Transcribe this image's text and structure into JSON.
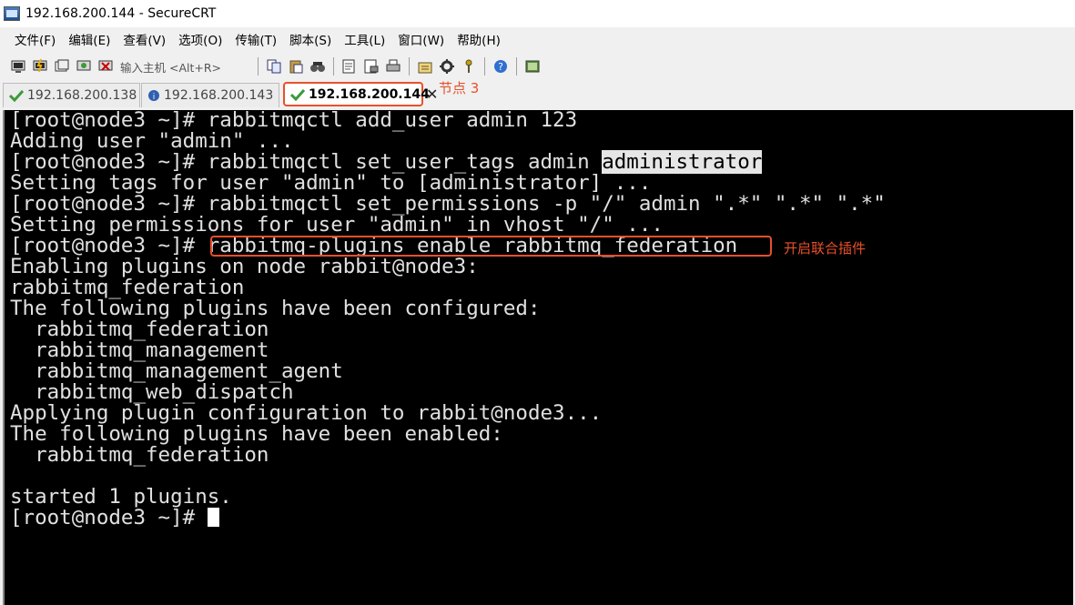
{
  "window": {
    "title": "192.168.200.144 - SecureCRT"
  },
  "menu": [
    "文件(F)",
    "编辑(E)",
    "查看(V)",
    "选项(O)",
    "传输(T)",
    "脚本(S)",
    "工具(L)",
    "窗口(W)",
    "帮助(H)"
  ],
  "toolbar": {
    "quick_connect_placeholder": "输入主机 <Alt+R>",
    "icons": [
      "connect-icon",
      "quick-connect-icon",
      "connect-tab-icon",
      "reconnect-icon",
      "disconnect-icon",
      "copy-icon",
      "paste-icon",
      "find-icon",
      "print-setup-icon",
      "print-icon",
      "printer-icon",
      "session-options-icon",
      "global-options-icon",
      "keymap-icon",
      "help-icon",
      "sftp-icon"
    ]
  },
  "tabs": [
    {
      "label": "192.168.200.138",
      "status_icon": "check-icon",
      "active": false
    },
    {
      "label": "192.168.200.143",
      "status_icon": "info-icon",
      "active": false
    },
    {
      "label": "192.168.200.144",
      "status_icon": "check-icon",
      "active": true
    }
  ],
  "annotations": {
    "tab_note": "节点 3",
    "command_note": "开启联合插件"
  },
  "terminal": {
    "lines": [
      "[root@node3 ~]# rabbitmqctl add_user admin 123",
      "Adding user \"admin\" ...",
      "[root@node3 ~]# rabbitmqctl set_user_tags admin ",
      "Setting tags for user \"admin\" to [administrator] ...",
      "[root@node3 ~]# rabbitmqctl set_permissions -p \"/\" admin \".*\" \".*\" \".*\"",
      "Setting permissions for user \"admin\" in vhost \"/\" ...",
      "[root@node3 ~]# rabbitmq-plugins enable rabbitmq_federation",
      "Enabling plugins on node rabbit@node3:",
      "rabbitmq_federation",
      "The following plugins have been configured:",
      "  rabbitmq_federation",
      "  rabbitmq_management",
      "  rabbitmq_management_agent",
      "  rabbitmq_web_dispatch",
      "Applying plugin configuration to rabbit@node3...",
      "The following plugins have been enabled:",
      "  rabbitmq_federation",
      "",
      "started 1 plugins.",
      "[root@node3 ~]# "
    ],
    "highlighted_word": "administrator"
  },
  "colors": {
    "accent": "#e8502a",
    "terminal_bg": "#000000",
    "terminal_fg": "#e0e0e0"
  }
}
